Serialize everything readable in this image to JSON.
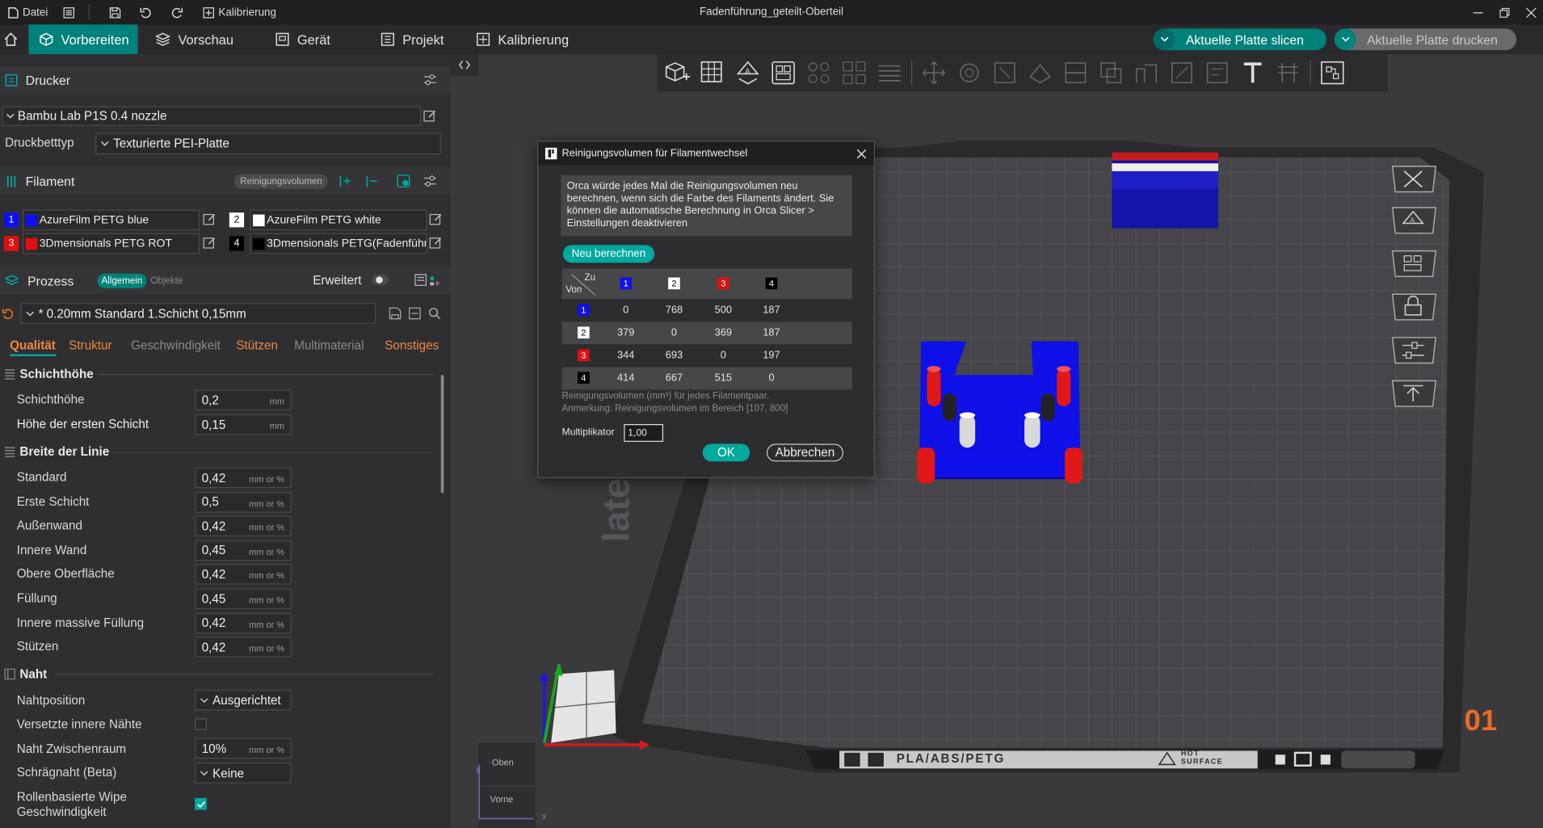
{
  "window": {
    "title": "Fadenführung_geteilt-Oberteil",
    "menu": {
      "file": "Datei",
      "calibration": "Kalibrierung"
    }
  },
  "tabs": [
    {
      "label": "Vorbereiten",
      "active": true
    },
    {
      "label": "Vorschau"
    },
    {
      "label": "Gerät"
    },
    {
      "label": "Projekt"
    },
    {
      "label": "Kalibrierung"
    }
  ],
  "actions": {
    "slice": "Aktuelle Platte slicen",
    "print": "Aktuelle Platte drucken"
  },
  "printer": {
    "header": "Drucker",
    "name": "Bambu Lab P1S 0.4 nozzle",
    "bed_label": "Druckbetttyp",
    "bed_value": "Texturierte PEI-Platte"
  },
  "filament": {
    "header": "Filament",
    "flush_button": "Reinigungsvolumen",
    "slots": [
      {
        "num": "1",
        "color": "#1010ee",
        "name": "AzureFilm PETG blue"
      },
      {
        "num": "2",
        "color": "#ffffff",
        "name": "AzureFilm PETG white"
      },
      {
        "num": "3",
        "color": "#e01010",
        "name": "3Dmensionals PETG ROT"
      },
      {
        "num": "4",
        "color": "#000000",
        "name": "3Dmensionals PETG(Fadenführ..."
      }
    ]
  },
  "process": {
    "header": "Prozess",
    "mode_general": "Allgemein",
    "mode_objects": "Objekte",
    "advanced": "Erweitert",
    "preset": "* 0.20mm Standard 1.Schicht 0,15mm",
    "tabs": [
      "Qualität",
      "Struktur",
      "Geschwindigkeit",
      "Stützen",
      "Multimaterial",
      "Sonstiges"
    ],
    "groups": {
      "layer_height": {
        "title": "Schichthöhe",
        "rows": [
          {
            "label": "Schichthöhe",
            "value": "0,2",
            "unit": "mm"
          },
          {
            "label": "Höhe der ersten Schicht",
            "value": "0,15",
            "unit": "mm"
          }
        ]
      },
      "line_width": {
        "title": "Breite der Linie",
        "rows": [
          {
            "label": "Standard",
            "value": "0,42",
            "unit": "mm or %"
          },
          {
            "label": "Erste Schicht",
            "value": "0,5",
            "unit": "mm or %"
          },
          {
            "label": "Außenwand",
            "value": "0,42",
            "unit": "mm or %"
          },
          {
            "label": "Innere Wand",
            "value": "0,45",
            "unit": "mm or %"
          },
          {
            "label": "Obere Oberfläche",
            "value": "0,42",
            "unit": "mm or %"
          },
          {
            "label": "Füllung",
            "value": "0,45",
            "unit": "mm or %"
          },
          {
            "label": "Innere massive Füllung",
            "value": "0,42",
            "unit": "mm or %"
          },
          {
            "label": "Stützen",
            "value": "0,42",
            "unit": "mm or %"
          }
        ]
      },
      "seam": {
        "title": "Naht",
        "position_label": "Nahtposition",
        "position_value": "Ausgerichtet",
        "staggered_label": "Versetzte innere Nähte",
        "gap_label": "Naht Zwischenraum",
        "gap_value": "10%",
        "gap_unit": "mm or %",
        "scarf_label": "Schrägnaht (Beta)",
        "scarf_value": "Keine",
        "wipe_label_1": "Rollenbasierte Wipe",
        "wipe_label_2": "Geschwindigkeit"
      }
    }
  },
  "viewport": {
    "plate_text": "PLA/ABS/PETG",
    "hot_surface_1": "HOT",
    "hot_surface_2": "SURFACE",
    "plate_number": "01",
    "plate_side_text": "late",
    "nav_top": "Oben",
    "nav_front": "Vorne",
    "axis_x": "x",
    "axis_y": "y"
  },
  "dialog": {
    "title": "Reinigungsvolumen für Filamentwechsel",
    "info": "Orca würde jedes Mal die Reinigungsvolumen neu berechnen, wenn sich die Farbe des Filaments ändert. Sie können die automatische Berechnung in Orca Slicer > Einstellungen deaktivieren",
    "recalc": "Neu berechnen",
    "to_label": "Zu",
    "from_label": "Von",
    "matrix": [
      {
        "from": "1",
        "values": [
          "0",
          "768",
          "500",
          "187"
        ]
      },
      {
        "from": "2",
        "values": [
          "379",
          "0",
          "369",
          "187"
        ]
      },
      {
        "from": "3",
        "values": [
          "344",
          "693",
          "0",
          "197"
        ]
      },
      {
        "from": "4",
        "values": [
          "414",
          "667",
          "515",
          "0"
        ]
      }
    ],
    "note1": "Reinigungsvolumen (mm³) für jedes Filamentpaar.",
    "note2": "Anmerkung: Reinigungsvolumen im Bereich [107, 800]",
    "multiplier_label": "Multiplikator",
    "multiplier_value": "1,00",
    "ok": "OK",
    "cancel": "Abbrechen"
  }
}
